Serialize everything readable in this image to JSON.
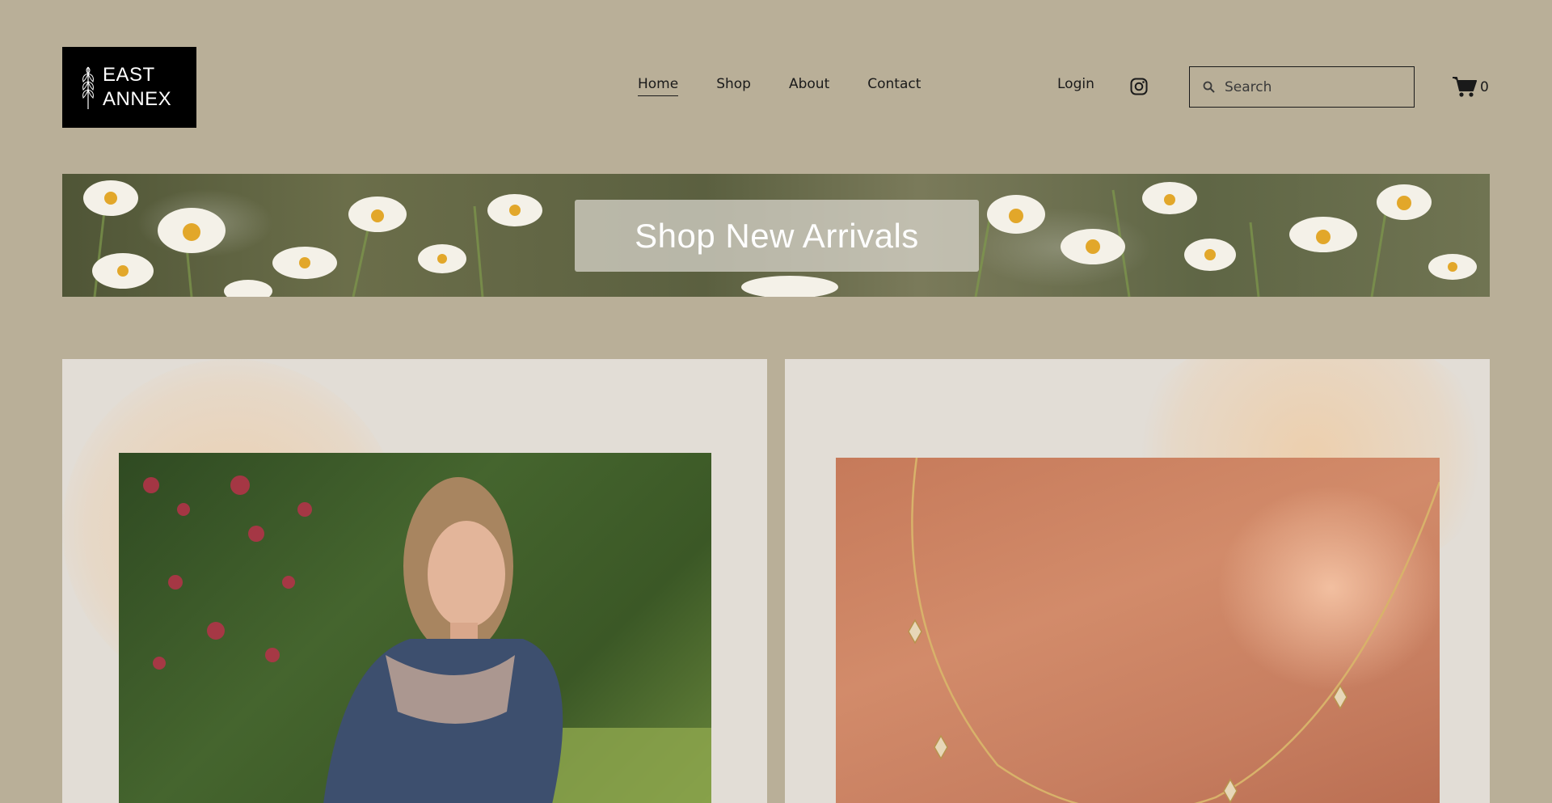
{
  "brand": {
    "line1": "EAST",
    "line2": "ANNEX"
  },
  "nav": {
    "items": [
      {
        "label": "Home",
        "active": true
      },
      {
        "label": "Shop",
        "active": false
      },
      {
        "label": "About",
        "active": false
      },
      {
        "label": "Contact",
        "active": false
      }
    ]
  },
  "header": {
    "login_label": "Login",
    "search_placeholder": "Search",
    "cart_count": "0"
  },
  "banner": {
    "cta_label": "Shop New Arrivals"
  },
  "colors": {
    "page_bg": "#b9af98",
    "card_bg": "#e2ddd6",
    "logo_bg": "#000000"
  }
}
